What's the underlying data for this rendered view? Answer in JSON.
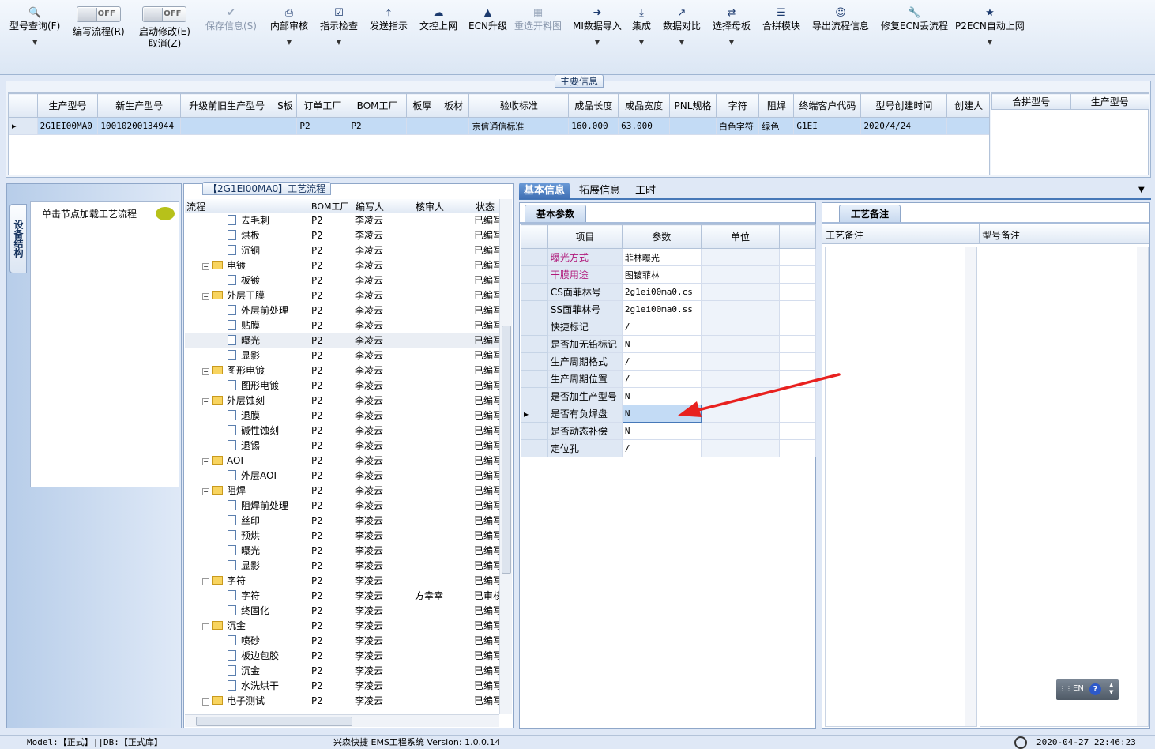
{
  "toolbar": {
    "buttons": [
      {
        "icon": "search-icon",
        "label": "型号查询(F)"
      },
      {
        "label": "编写流程(R)",
        "toggle": "OFF"
      },
      {
        "label": "启动修改(E)",
        "label2": "取消(Z)",
        "toggle": "OFF"
      },
      {
        "icon": "check-icon",
        "label": "保存信息(S)"
      },
      {
        "icon": "printer-icon",
        "label": "内部审核"
      },
      {
        "icon": "checkbox-icon",
        "label": "指示检查"
      },
      {
        "icon": "upload-icon",
        "label": "发送指示"
      },
      {
        "icon": "cloud-upload-icon",
        "label": "文控上网"
      },
      {
        "icon": "ecn-icon",
        "label": "ECN升级"
      },
      {
        "icon": "image-icon",
        "label": "重选开料图"
      },
      {
        "icon": "import-icon",
        "label": "MI数据导入"
      },
      {
        "icon": "download-icon",
        "label": "集成"
      },
      {
        "icon": "compare-icon",
        "label": "数据对比"
      },
      {
        "icon": "shuffle-icon",
        "label": "选择母板"
      },
      {
        "icon": "list-icon",
        "label": "合拼模块"
      },
      {
        "icon": "smile-icon",
        "label": "导出流程信息"
      },
      {
        "icon": "wrench-icon",
        "label": "修复ECN丢流程"
      },
      {
        "icon": "star-icon",
        "label": "P2ECN自动上网"
      }
    ]
  },
  "main_info": {
    "caption": "主要信息",
    "columns": [
      "生产型号",
      "新生产型号",
      "升级前旧生产型号",
      "S板",
      "订单工厂",
      "BOM工厂",
      "板厚",
      "板材",
      "验收标准",
      "成品长度",
      "成品宽度",
      "PNL规格",
      "字符",
      "阻焊",
      "终端客户代码",
      "型号创建时间",
      "创建人"
    ],
    "row": [
      "2G1EI00MA0",
      "10010200134944",
      "",
      "",
      "P2",
      "P2",
      "",
      "",
      "京信通信标准",
      "160.000",
      "63.000",
      "",
      "白色字符",
      "绿色",
      "G1EI",
      "2020/4/24",
      ""
    ],
    "merge_columns": [
      "合拼型号",
      "生产型号"
    ]
  },
  "side": {
    "vertical_tab": "设备结构",
    "hint": "单击节点加载工艺流程"
  },
  "tree": {
    "caption": "【2G1EI00MA0】工艺流程",
    "columns": [
      "流程",
      "BOM工厂",
      "编写人",
      "核审人",
      "状态"
    ],
    "rows": [
      {
        "name": "去毛刺",
        "level": 2,
        "bom": "P2",
        "writer": "李凌云",
        "reviewer": "",
        "status": "已编写"
      },
      {
        "name": "烘板",
        "level": 2,
        "bom": "P2",
        "writer": "李凌云",
        "reviewer": "",
        "status": "已编写"
      },
      {
        "name": "沉铜",
        "level": 2,
        "bom": "P2",
        "writer": "李凌云",
        "reviewer": "",
        "status": "已编写"
      },
      {
        "name": "电镀",
        "level": 1,
        "bom": "P2",
        "writer": "李凌云",
        "reviewer": "",
        "status": "已编写"
      },
      {
        "name": "板镀",
        "level": 2,
        "bom": "P2",
        "writer": "李凌云",
        "reviewer": "",
        "status": "已编写"
      },
      {
        "name": "外层干膜",
        "level": 1,
        "bom": "P2",
        "writer": "李凌云",
        "reviewer": "",
        "status": "已编写"
      },
      {
        "name": "外层前处理",
        "level": 2,
        "bom": "P2",
        "writer": "李凌云",
        "reviewer": "",
        "status": "已编写"
      },
      {
        "name": "贴膜",
        "level": 2,
        "bom": "P2",
        "writer": "李凌云",
        "reviewer": "",
        "status": "已编写"
      },
      {
        "name": "曝光",
        "level": 2,
        "bom": "P2",
        "writer": "李凌云",
        "reviewer": "",
        "status": "已编写",
        "selected": true
      },
      {
        "name": "显影",
        "level": 2,
        "bom": "P2",
        "writer": "李凌云",
        "reviewer": "",
        "status": "已编写"
      },
      {
        "name": "图形电镀",
        "level": 1,
        "bom": "P2",
        "writer": "李凌云",
        "reviewer": "",
        "status": "已编写"
      },
      {
        "name": "图形电镀",
        "level": 2,
        "bom": "P2",
        "writer": "李凌云",
        "reviewer": "",
        "status": "已编写"
      },
      {
        "name": "外层蚀刻",
        "level": 1,
        "bom": "P2",
        "writer": "李凌云",
        "reviewer": "",
        "status": "已编写"
      },
      {
        "name": "退膜",
        "level": 2,
        "bom": "P2",
        "writer": "李凌云",
        "reviewer": "",
        "status": "已编写"
      },
      {
        "name": "碱性蚀刻",
        "level": 2,
        "bom": "P2",
        "writer": "李凌云",
        "reviewer": "",
        "status": "已编写"
      },
      {
        "name": "退锡",
        "level": 2,
        "bom": "P2",
        "writer": "李凌云",
        "reviewer": "",
        "status": "已编写"
      },
      {
        "name": "AOI",
        "level": 1,
        "bom": "P2",
        "writer": "李凌云",
        "reviewer": "",
        "status": "已编写"
      },
      {
        "name": "外层AOI",
        "level": 2,
        "bom": "P2",
        "writer": "李凌云",
        "reviewer": "",
        "status": "已编写"
      },
      {
        "name": "阻焊",
        "level": 1,
        "bom": "P2",
        "writer": "李凌云",
        "reviewer": "",
        "status": "已编写"
      },
      {
        "name": "阻焊前处理",
        "level": 2,
        "bom": "P2",
        "writer": "李凌云",
        "reviewer": "",
        "status": "已编写"
      },
      {
        "name": "丝印",
        "level": 2,
        "bom": "P2",
        "writer": "李凌云",
        "reviewer": "",
        "status": "已编写"
      },
      {
        "name": "预烘",
        "level": 2,
        "bom": "P2",
        "writer": "李凌云",
        "reviewer": "",
        "status": "已编写"
      },
      {
        "name": "曝光",
        "level": 2,
        "bom": "P2",
        "writer": "李凌云",
        "reviewer": "",
        "status": "已编写"
      },
      {
        "name": "显影",
        "level": 2,
        "bom": "P2",
        "writer": "李凌云",
        "reviewer": "",
        "status": "已编写"
      },
      {
        "name": "字符",
        "level": 1,
        "bom": "P2",
        "writer": "李凌云",
        "reviewer": "",
        "status": "已编写"
      },
      {
        "name": "字符",
        "level": 2,
        "bom": "P2",
        "writer": "李凌云",
        "reviewer": "方幸幸",
        "status": "已审核"
      },
      {
        "name": "终固化",
        "level": 2,
        "bom": "P2",
        "writer": "李凌云",
        "reviewer": "",
        "status": "已编写"
      },
      {
        "name": "沉金",
        "level": 1,
        "bom": "P2",
        "writer": "李凌云",
        "reviewer": "",
        "status": "已编写"
      },
      {
        "name": "喷砂",
        "level": 2,
        "bom": "P2",
        "writer": "李凌云",
        "reviewer": "",
        "status": "已编写"
      },
      {
        "name": "板边包胶",
        "level": 2,
        "bom": "P2",
        "writer": "李凌云",
        "reviewer": "",
        "status": "已编写"
      },
      {
        "name": "沉金",
        "level": 2,
        "bom": "P2",
        "writer": "李凌云",
        "reviewer": "",
        "status": "已编写"
      },
      {
        "name": "水洗烘干",
        "level": 2,
        "bom": "P2",
        "writer": "李凌云",
        "reviewer": "",
        "status": "已编写"
      },
      {
        "name": "电子测试",
        "level": 1,
        "bom": "P2",
        "writer": "李凌云",
        "reviewer": "",
        "status": "已编写"
      }
    ]
  },
  "right": {
    "tabs": [
      "基本信息",
      "拓展信息",
      "工时"
    ],
    "basic_subtab": "基本参数",
    "param_columns": [
      "项目",
      "参数",
      "单位"
    ],
    "params": [
      {
        "item": "曝光方式",
        "value": "菲林曝光",
        "highlight": true
      },
      {
        "item": "干膜用途",
        "value": "图镀菲林",
        "highlight": true
      },
      {
        "item": "CS面菲林号",
        "value": "2g1ei00ma0.cs"
      },
      {
        "item": "SS面菲林号",
        "value": "2g1ei00ma0.ss"
      },
      {
        "item": "快捷标记",
        "value": "/"
      },
      {
        "item": "是否加无铅标记",
        "value": "N"
      },
      {
        "item": "生产周期格式",
        "value": "/"
      },
      {
        "item": "生产周期位置",
        "value": "/"
      },
      {
        "item": "是否加生产型号",
        "value": "N"
      },
      {
        "item": "是否有负焊盘",
        "value": "N",
        "current": true
      },
      {
        "item": "是否动态补偿",
        "value": "N"
      },
      {
        "item": "定位孔",
        "value": "/"
      }
    ],
    "remark_subtab": "工艺备注",
    "remark_columns": [
      "工艺备注",
      "型号备注"
    ]
  },
  "status": {
    "model": "Model:【正式】||DB:【正式库】",
    "app": "兴森快捷 EMS工程系统 Version: 1.0.0.14",
    "datetime": "2020-04-27 22:46:23"
  },
  "lang_widget": {
    "label": "EN"
  },
  "colors": {
    "accent": "#3e6fb3",
    "selected": "#c3dbf5",
    "highlight_text": "#b0187a",
    "annotation": "#e8211f"
  }
}
